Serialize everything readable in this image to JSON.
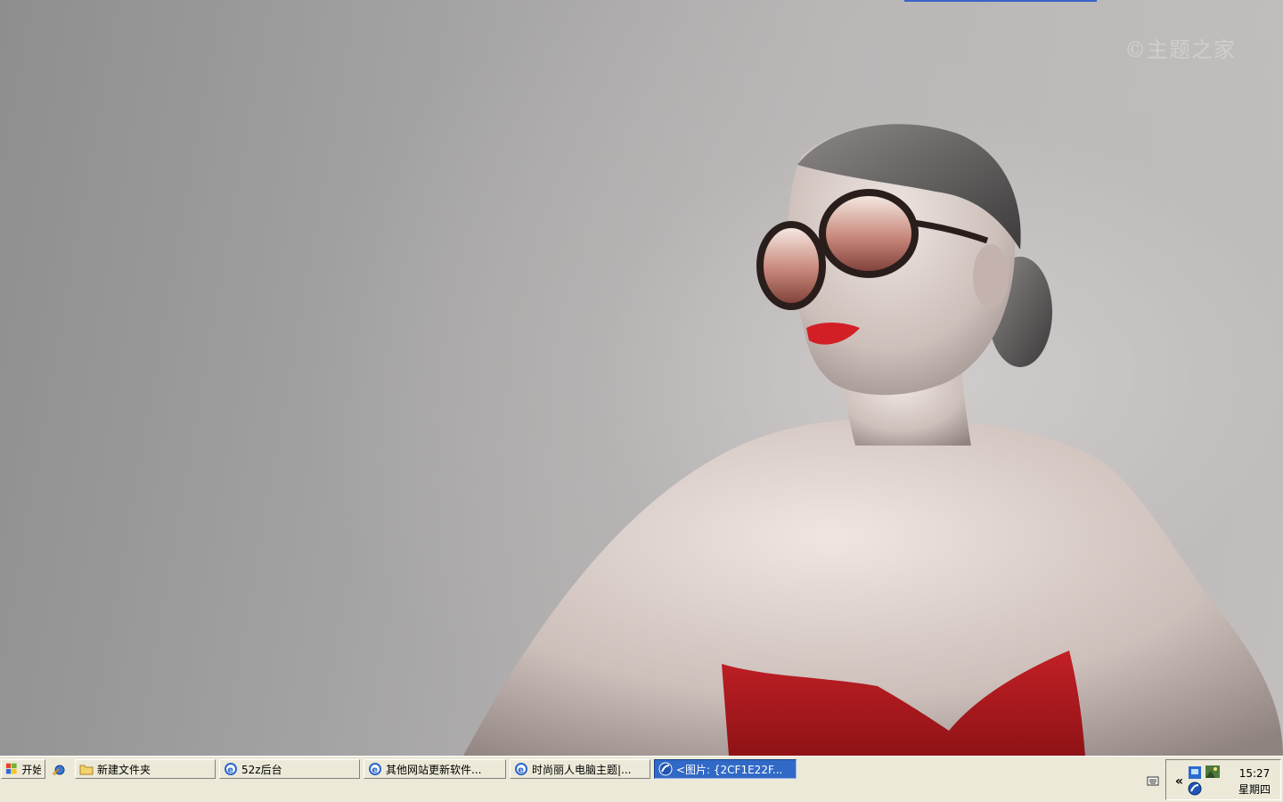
{
  "desktop": {
    "watermark": "©主题之家"
  },
  "taskbar": {
    "start_label": "开始",
    "windows": [
      {
        "label": "新建文件夹",
        "icon": "folder-icon",
        "active": false
      },
      {
        "label": "52z后台",
        "icon": "ie-icon",
        "active": false
      },
      {
        "label": "其他网站更新软件...",
        "icon": "ie-icon",
        "active": false
      },
      {
        "label": "时尚丽人电脑主题|...",
        "icon": "ie-icon",
        "active": false
      },
      {
        "label": "<图片: {2CF1E22F...",
        "icon": "viewer-icon",
        "active": true
      }
    ],
    "tray": {
      "time": "15:27",
      "day": "星期四",
      "expand_label": "«"
    }
  },
  "colors": {
    "taskbar_bg": "#ece9d8",
    "active_window": "#3169c6",
    "dress_red": "#b3191e",
    "lipstick": "#d21f25"
  }
}
